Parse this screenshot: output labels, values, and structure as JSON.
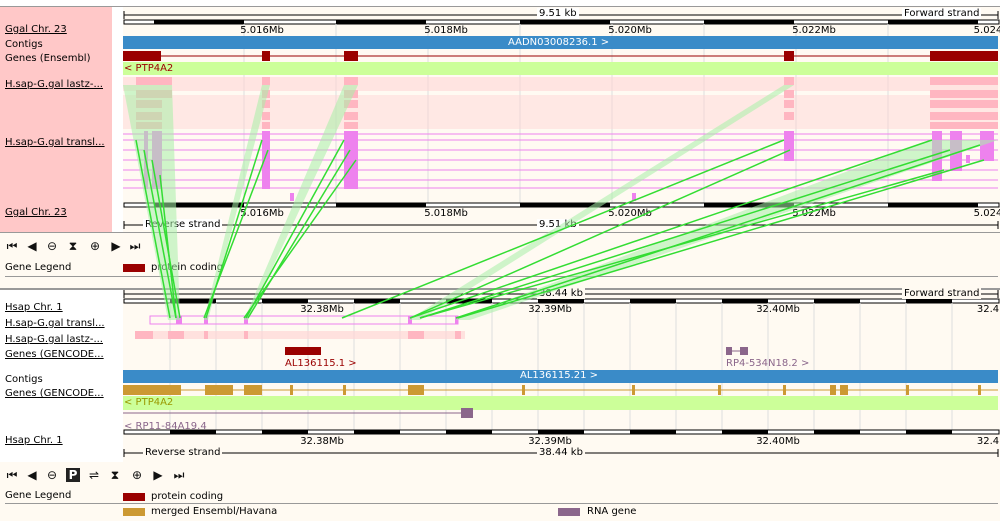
{
  "top": {
    "labels": {
      "chr_top": "Ggal Chr. 23",
      "contigs": "Contigs",
      "genes": "Genes (Ensembl)",
      "lastz": "H.sap-G.gal lastz-...",
      "transl": "H.sap-G.gal transl...",
      "chr_bottom": "Ggal Chr. 23"
    },
    "span": "9.51 kb",
    "forward_strand": "Forward strand",
    "reverse_strand": "Reverse strand",
    "ticks": [
      "5.016Mb",
      "5.018Mb",
      "5.020Mb",
      "5.022Mb",
      "5.024"
    ],
    "contig_label": "AADN03008236.1 >",
    "gene_label": "< PTP4A2",
    "legend_title": "Gene Legend",
    "legend": [
      {
        "label": "protein coding",
        "color": "#9a0000"
      }
    ]
  },
  "bottom": {
    "labels": {
      "chr_top": "Hsap Chr. 1",
      "transl": "H.sap-G.gal transl...",
      "lastz": "H.sap-G.gal lastz-...",
      "genes1": "Genes (GENCODE...",
      "contigs": "Contigs",
      "genes2": "Genes (GENCODE...",
      "chr_bottom": "Hsap Chr. 1"
    },
    "span": "38.44 kb",
    "forward_strand": "Forward strand",
    "reverse_strand": "Reverse strand",
    "ticks": [
      "32.38Mb",
      "32.39Mb",
      "32.40Mb",
      "32.4"
    ],
    "contig_label": "AL136115.21 >",
    "gene_fwd_1": "AL136115.1 >",
    "gene_fwd_2": "RP4-534N18.2 >",
    "gene_rev_1": "< PTP4A2",
    "gene_rev_2": "< RP11-84A19.4",
    "legend_title": "Gene Legend",
    "legend": [
      {
        "label": "protein coding",
        "color": "#9a0000"
      },
      {
        "label": "merged Ensembl/Havana",
        "color": "#cc9933"
      },
      {
        "label": "RNA gene",
        "color": "#8b668b"
      }
    ]
  },
  "colors": {
    "label_bg": "#ffc8c8",
    "contig": "#3a8bc8",
    "gene_band": "#ccff99",
    "coding": "#9a0000",
    "merged": "#cc9933",
    "rna": "#8b668b",
    "align_pink": "#ffb6c1",
    "transl_violet": "#ee82ee",
    "link_green": "#33dd33",
    "link_light": "#a8f0a8"
  }
}
